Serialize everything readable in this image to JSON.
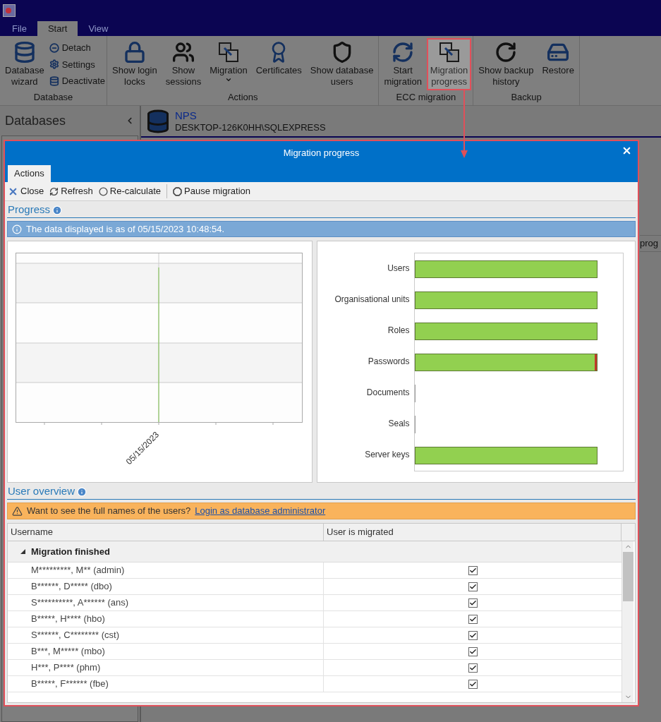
{
  "menu_tabs": [
    {
      "label": "File",
      "selected": false
    },
    {
      "label": "Start",
      "selected": true
    },
    {
      "label": "View",
      "selected": false
    }
  ],
  "ribbon_groups": [
    {
      "label": "Database",
      "buttons": [
        {
          "lines": [
            "Database",
            "wizard"
          ],
          "highlighted": false,
          "has_menu": false
        }
      ],
      "small_buttons": [
        {
          "label": "Detach"
        },
        {
          "label": "Settings"
        },
        {
          "label": "Deactivate"
        }
      ]
    },
    {
      "label": "Actions",
      "buttons": [
        {
          "lines": [
            "Show login",
            "locks"
          ],
          "highlighted": false,
          "has_menu": false
        },
        {
          "lines": [
            "Show",
            "sessions"
          ],
          "highlighted": false,
          "has_menu": false
        },
        {
          "lines": [
            "Migration"
          ],
          "highlighted": false,
          "has_menu": true
        },
        {
          "lines": [
            "Certificates"
          ],
          "highlighted": false,
          "has_menu": false
        },
        {
          "lines": [
            "Show database",
            "users"
          ],
          "highlighted": false,
          "has_menu": false
        }
      ]
    },
    {
      "label": "ECC migration",
      "buttons": [
        {
          "lines": [
            "Start",
            "migration"
          ],
          "highlighted": false,
          "has_menu": false
        },
        {
          "lines": [
            "Migration",
            "progress"
          ],
          "highlighted": true,
          "has_menu": false
        }
      ]
    },
    {
      "label": "Backup",
      "buttons": [
        {
          "lines": [
            "Show backup",
            "history"
          ],
          "highlighted": false,
          "has_menu": false
        },
        {
          "lines": [
            "Restore"
          ],
          "highlighted": false,
          "has_menu": false
        }
      ]
    }
  ],
  "sidebar": {
    "title": "Databases"
  },
  "database_header": {
    "name": "NPS",
    "server": "DESKTOP-126K0HH\\SQLEXPRESS"
  },
  "background_table": {
    "visible_text": "prog"
  },
  "dialog": {
    "title": "Migration progress",
    "tabs": [
      {
        "label": "Actions",
        "selected": true
      }
    ],
    "toolbar": [
      {
        "label": "Close",
        "separator_before": false
      },
      {
        "label": "Refresh",
        "separator_before": false
      },
      {
        "label": "Re-calculate",
        "separator_before": false
      },
      {
        "label": "Pause migration",
        "separator_before": true
      }
    ],
    "progress": {
      "title": "Progress",
      "info": "The data displayed is as of 05/15/2023 10:48:54.",
      "timeline_chart": {
        "x_label": "05/15/2023"
      },
      "bars": [
        {
          "label": "Users",
          "level": 1,
          "has_errors": false
        },
        {
          "label": "Organisational units",
          "level": 1,
          "has_errors": false
        },
        {
          "label": "Roles",
          "level": 1,
          "has_errors": false
        },
        {
          "label": "Passwords",
          "level": 1,
          "has_errors": true
        },
        {
          "label": "Documents",
          "level": 0,
          "has_errors": false
        },
        {
          "label": "Seals",
          "level": 0,
          "has_errors": false
        },
        {
          "label": "Server keys",
          "level": 1,
          "has_errors": false
        }
      ]
    },
    "user_overview": {
      "title": "User overview",
      "warning": "Want to see the full names of the users?",
      "link": "Login as database administrator",
      "columns": [
        "Username",
        "User is migrated"
      ],
      "groups": [
        {
          "label": "Migration finished",
          "expanded": true,
          "rows": [
            {
              "username": "M*********, M** (admin)",
              "migrated": true
            },
            {
              "username": "B******, D***** (dbo)",
              "migrated": true
            },
            {
              "username": "S**********, A****** (ans)",
              "migrated": true
            },
            {
              "username": "B*****, H**** (hbo)",
              "migrated": true
            },
            {
              "username": "S******, C******** (cst)",
              "migrated": true
            },
            {
              "username": "B***, M***** (mbo)",
              "migrated": true
            },
            {
              "username": "H***, P**** (phm)",
              "migrated": true
            },
            {
              "username": "B*****, F****** (fbe)",
              "migrated": true
            }
          ]
        }
      ]
    }
  }
}
